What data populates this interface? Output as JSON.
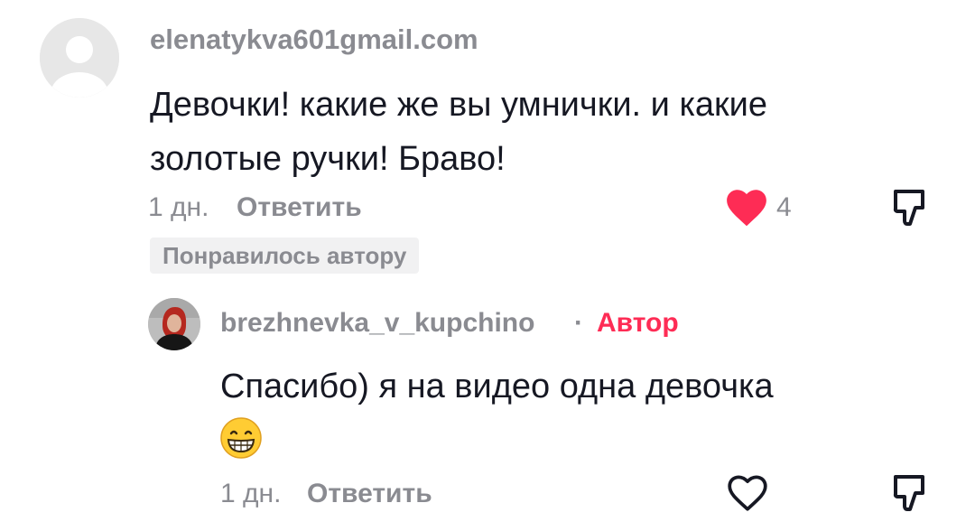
{
  "comment": {
    "username": "elenatykva601gmail.com",
    "text_line1": "Девочки! какие же вы умнички. и какие",
    "text_line2": "золотые ручки! Браво!",
    "date": "1 дн.",
    "reply_label": "Ответить",
    "like_count": "4",
    "liked": true,
    "liked_by_author": "Понравилось автору"
  },
  "reply": {
    "username": "brezhnevka_v_kupchino",
    "separator": "·",
    "author_tag": "Автор",
    "text": "Спасибо) я на видео одна девочка",
    "emoji": "grinning-face-emoji",
    "date": "1 дн.",
    "reply_label": "Ответить",
    "liked": false
  },
  "colors": {
    "like_active": "#fe2c55",
    "author_tag": "#fe2c55",
    "secondary_text": "#8a8b91",
    "primary_text": "#161823"
  }
}
